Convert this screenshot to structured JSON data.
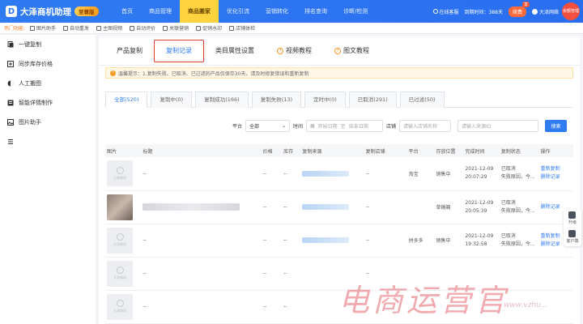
{
  "header": {
    "logo_text": "大泽商机助理",
    "vip_label": "至尊版",
    "nav": [
      "首页",
      "商品管理",
      "商品搬家",
      "优化引流",
      "营销转化",
      "排名查询",
      "诊断/检测"
    ],
    "active_nav_index": 2,
    "online_status": "在线客服",
    "expiry": "到期时间：388天",
    "renew": "续费",
    "renew_tag": "享",
    "username": "大泽网络",
    "side_badge": "余额管理"
  },
  "quickbar": {
    "label": "热门功能:",
    "items": [
      "图片助手",
      "自动重发",
      "主图视频",
      "自动评价",
      "关联营销",
      "促销水印",
      "店铺体检"
    ]
  },
  "sidebar": {
    "items": [
      {
        "label": "一键复制",
        "icon": "copy-icon"
      },
      {
        "label": "同步库存价格",
        "icon": "sync-icon"
      },
      {
        "label": "人工搬图",
        "icon": "image-move-icon"
      },
      {
        "label": "智能详情制作",
        "icon": "detail-icon"
      },
      {
        "label": "图片助手",
        "icon": "image-icon"
      },
      {
        "label": "",
        "icon": "list-icon"
      }
    ]
  },
  "tabs": [
    "产品复制",
    "复制记录",
    "类目属性设置",
    "视频教程",
    "图文教程"
  ],
  "active_tab_index": 1,
  "notice": "温馨提示：1.复制失败、已取消、已过滤的产品仅保存30天，请及时修复错误和重新复制",
  "status_tabs": [
    "全部(520)",
    "复制中(0)",
    "复制成功(166)",
    "复制失败(13)",
    "定时中(0)",
    "已取消(291)",
    "已过滤(50)"
  ],
  "active_status_index": 0,
  "filters": {
    "platform_label": "平台",
    "platform_value": "全部",
    "time_label": "时间",
    "start_placeholder": "开始日期",
    "date_sep": "至",
    "end_placeholder": "结束日期",
    "shop_label": "店铺",
    "shop_placeholder": "请输入店铺名称",
    "source_placeholder": "请输入来源ID",
    "search_label": "搜索"
  },
  "table": {
    "headers": [
      "图片",
      "标题",
      "价格",
      "库存",
      "复制来源",
      "复制店铺",
      "平台",
      "存放位置",
      "完成时间",
      "复制状态",
      "操作"
    ],
    "thumb_text": "大泽商机",
    "rows": [
      {
        "title": "--",
        "price": "--",
        "stock": "--",
        "shop": "--",
        "platform": "淘宝",
        "location": "销售中",
        "time1": "2021-12-09",
        "time2": "20:07:29",
        "status1": "已取消",
        "status2": "失败原因，今...",
        "op1": "重新复制",
        "op2": "删除记录",
        "photo": false
      },
      {
        "title": "",
        "price": "--",
        "stock": "--",
        "shop": "--",
        "platform": "",
        "location": "草稿箱",
        "time1": "2021-12-09",
        "time2": "20:05:39",
        "status1": "已取消",
        "status2": "失败原因，今...",
        "op1": "",
        "op2": "删除记录",
        "photo": true
      },
      {
        "title": "--",
        "price": "--",
        "stock": "--",
        "shop": "--",
        "platform": "拼多多",
        "location": "销售中",
        "time1": "2021-12-09",
        "time2": "19:32:58",
        "status1": "已取消",
        "status2": "失败原因，今...",
        "op1": "重新复制",
        "op2": "删除记录",
        "photo": false
      },
      {
        "title": "--",
        "price": "--",
        "stock": "--",
        "shop": "--",
        "platform": "",
        "location": "",
        "time1": "",
        "time2": "",
        "status1": "",
        "status2": "",
        "op1": "",
        "op2": "",
        "photo": false
      },
      {
        "title": "--",
        "price": "--",
        "stock": "--",
        "shop": "",
        "platform": "",
        "location": "",
        "time1": "",
        "time2": "",
        "status1": "",
        "status2": "",
        "op1": "",
        "op2": "",
        "photo": false
      }
    ]
  },
  "float_tools": [
    "升级",
    "客户端"
  ],
  "watermark": "电商运营官",
  "watermark_sub": "www.vzhu..."
}
